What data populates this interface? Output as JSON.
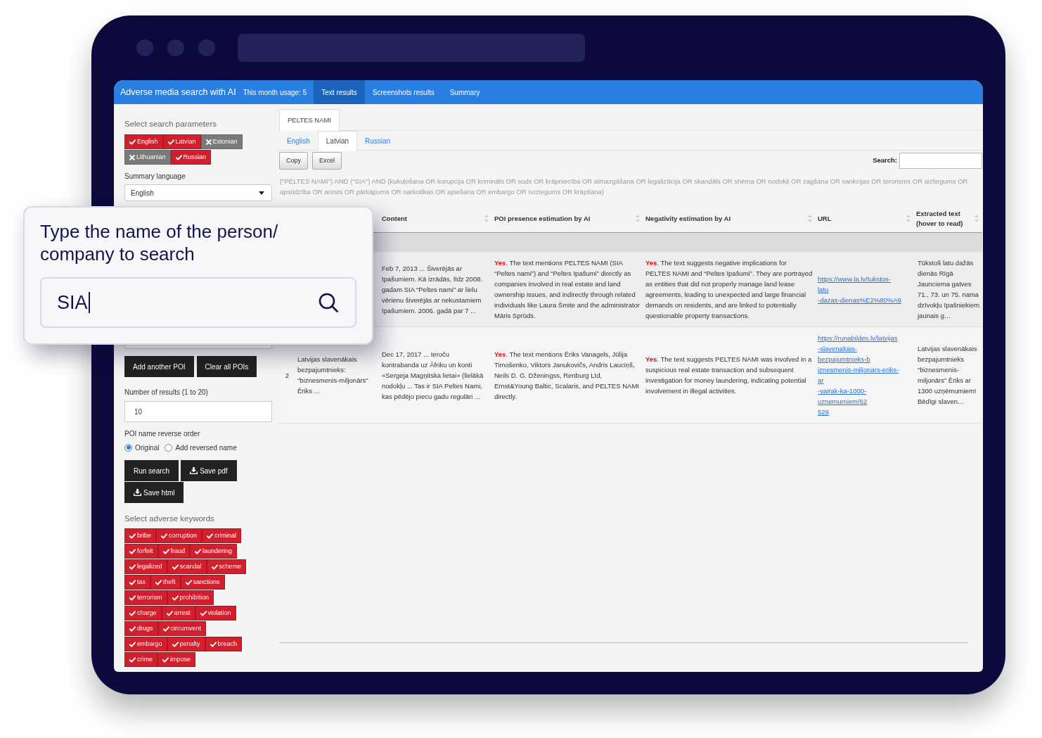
{
  "app": {
    "title": "Adverse media search with AI",
    "usage": "This month usage: 5",
    "nav_tabs": [
      {
        "label": "Text results",
        "selected": true
      },
      {
        "label": "Screenshots results",
        "selected": false
      },
      {
        "label": "Summary",
        "selected": false
      }
    ]
  },
  "sidebar": {
    "search_params_title": "Select search parameters",
    "languages": [
      {
        "label": "English",
        "selected": true
      },
      {
        "label": "Latvian",
        "selected": true
      },
      {
        "label": "Estonian",
        "selected": false
      },
      {
        "label": "Lithuanian",
        "selected": false
      },
      {
        "label": "Russian",
        "selected": true
      }
    ],
    "summary_language": {
      "label": "Summary language",
      "value": "English"
    },
    "poi_buttons": [
      "Add another POI",
      "Clear all POIs"
    ],
    "results_count": {
      "label": "Number of results (1 to 20)",
      "value": "10"
    },
    "reverse_order": {
      "label": "POI name reverse order",
      "options": [
        {
          "label": "Original",
          "selected": true
        },
        {
          "label": "Add reversed name",
          "selected": false
        }
      ]
    },
    "action_buttons": [
      {
        "label": "Run search",
        "kind": "plain"
      },
      {
        "label": "Save pdf",
        "kind": "download"
      },
      {
        "label": "Save html",
        "kind": "download"
      }
    ],
    "keywords_title": "Select adverse keywords",
    "keywords": [
      {
        "label": "bribe",
        "selected": true
      },
      {
        "label": "corruption",
        "selected": true
      },
      {
        "label": "criminal",
        "selected": true
      },
      {
        "label": "forfeit",
        "selected": true
      },
      {
        "label": "fraud",
        "selected": true
      },
      {
        "label": "laundering",
        "selected": true
      },
      {
        "label": "legalized",
        "selected": true
      },
      {
        "label": "scandal",
        "selected": true
      },
      {
        "label": "scheme",
        "selected": true
      },
      {
        "label": "tax",
        "selected": true
      },
      {
        "label": "theft",
        "selected": true
      },
      {
        "label": "sanctions",
        "selected": true
      },
      {
        "label": "terrorism",
        "selected": true
      },
      {
        "label": "prohibition",
        "selected": true
      },
      {
        "label": "charge",
        "selected": true
      },
      {
        "label": "arrest",
        "selected": true
      },
      {
        "label": "violation",
        "selected": true
      },
      {
        "label": "drugs",
        "selected": true
      },
      {
        "label": "circumvent",
        "selected": true
      },
      {
        "label": "embargo",
        "selected": true
      },
      {
        "label": "penalty",
        "selected": true
      },
      {
        "label": "breach",
        "selected": true
      },
      {
        "label": "crime",
        "selected": true
      },
      {
        "label": "impose",
        "selected": true
      }
    ]
  },
  "results": {
    "poi_tabs": [
      {
        "label": "PELTES NAMI",
        "selected": true
      }
    ],
    "language_tabs": [
      {
        "label": "English",
        "selected": false
      },
      {
        "label": "Latvian",
        "selected": true
      },
      {
        "label": "Russian",
        "selected": false
      }
    ],
    "export_buttons": [
      "Copy",
      "Excel"
    ],
    "search": {
      "label": "Search:"
    },
    "query": "(\"PELTES NAMI\") AND (\"SIA\") AND (kukuļošana OR korupcija OR krimināls OR sods OR krāpniecība OR atmazgāšana OR legalizācija OR skandāls OR shēma OR nodokļi OR zagšana OR sankcijas OR terorisms OR aizliegums OR apsūdzība OR arests OR pārkāpums OR narkotikas OR apiešana OR embargo OR noziegums OR krāpšana)",
    "table": {
      "columns": [
        "Content",
        "POI presence estimation by AI",
        "Negativity estimation by AI",
        "URL",
        "Extracted text (hover to read)"
      ],
      "rows": [
        {
          "content": "Feb 7, 2013 ... Šiverējās ar īpašumiem. Kā izrādās, līdz 2008. gadam SIA “Peltes nami” ar lielu vērienu šiverējās ar nekustamiem īpašumiem. 2006. gadā par 7 ...",
          "poi_presence": {
            "verdict": "Yes",
            "text": ". The text mentions PELTES NAMI (SIA “Peltes nami”) and “Peltes īpašumi” directly as companies involved in real estate and land ownership issues, and indirectly through related individuals like Laura Šmite and the administrator Māris Sprūds."
          },
          "negativity": {
            "verdict": "Yes",
            "text": ". The text suggests negative implications for PELTES NAMI and “Peltes īpašumi”. They are portrayed as entities that did not properly manage land lease agreements, leading to unexpected and large financial demands on residents, and are linked to potentially questionable property transactions."
          },
          "url": "https://www.la.lv/tukstos-\nlatu\n-dazas-dienas%E2%80%A9",
          "extracted_text": "Tūkstoš latu dažās dienās Rīgā Jaunciema gatves 71., 73. un 75. nama dzīvokļu īpašniekiem jaunais g…"
        },
        {
          "number": "2",
          "title": "Latvijas slavenākais bezpajumtnieks: \"biznesmenis-miljonārs\" Ēriks ...",
          "content": "Dec 17, 2017 ... Ieroču kontrabanda uz Āfriku un konti «Sergeja Magņitska lietai» (lielākā nodokļu ... Tas ir SIA Peltes Nami, kas pēdējo piecu gadu regulāri ...",
          "poi_presence": {
            "verdict": "Yes",
            "text": ". The text mentions Ēriks Vanagels, Jūlija Timošenko, Viktors Janukovičs, Andris Lauciņš, Neils D. G. Dženingss, Renburg Ltd, Ernst&Young Baltic, Scalaris, and PELTES NAMI directly."
          },
          "negativity": {
            "verdict": "Yes",
            "text": ". The text suggests PELTES NAMI was involved in a suspicious real estate transaction and subsequent investigation for money laundering, indicating potential involvement in illegal activities."
          },
          "url": "https://runabildes.lv/latvijas\n-slavenakais-\nbezpajumtnieks-b\niznesmenis-miljonars-eriks-\nar\n-vairak-ka-1000-\nuznemumiem/62\n529",
          "extracted_text": "Latvijas slavenākais bezpajumtnieks “biznesmenis-miljonārs” Ēriks ar 1300 uzņēmumiem! Bēdīgi slaven…"
        }
      ]
    }
  },
  "callout": {
    "heading": "Type the name of the person/\ncompany to search",
    "search_field": {
      "value": "SIA"
    }
  }
}
